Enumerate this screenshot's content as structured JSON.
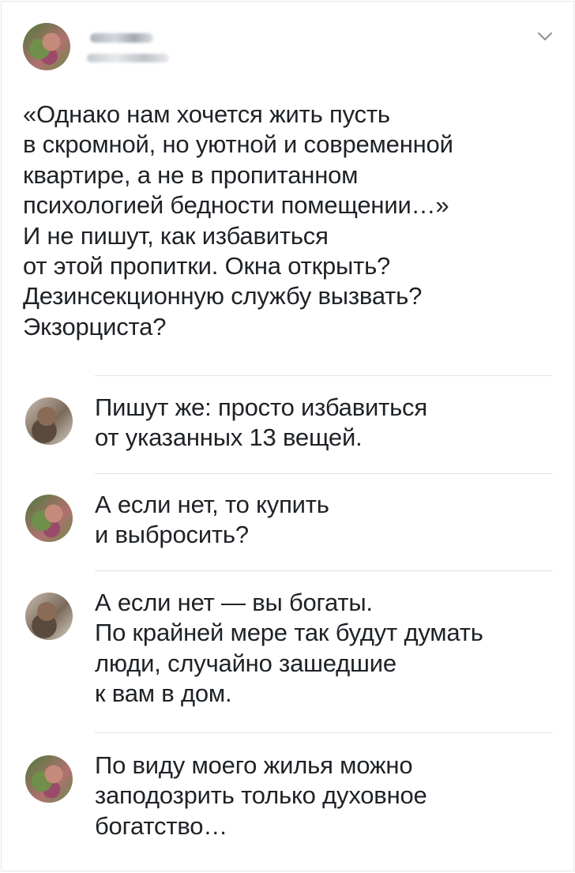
{
  "post": {
    "text": "«Однако нам хочется жить пусть\nв скромной, но уютной и современной\nквартире, а не в пропитанном\nпсихологией бедности помещении…»\nИ не пишут, как избавиться\nот этой пропитки. Окна открыть?\nДезинсекционную службу вызвать?\nЭкзорциста?",
    "menu_icon": "chevron-down-icon"
  },
  "replies": [
    {
      "text": "Пишут же: просто избавиться\nот указанных 13 вещей."
    },
    {
      "text": "А если нет, то купить\nи выбросить?"
    },
    {
      "text": "А если нет — вы богаты.\nПо крайней мере так будут думать\nлюди, случайно зашедшие\nк вам в дом."
    },
    {
      "text": "По виду моего жилья можно\nзаподозрить только духовное\nбогатство…"
    }
  ],
  "colors": {
    "text": "#1e2226",
    "divider": "#e3e3e3",
    "chevron": "#8a9097"
  }
}
